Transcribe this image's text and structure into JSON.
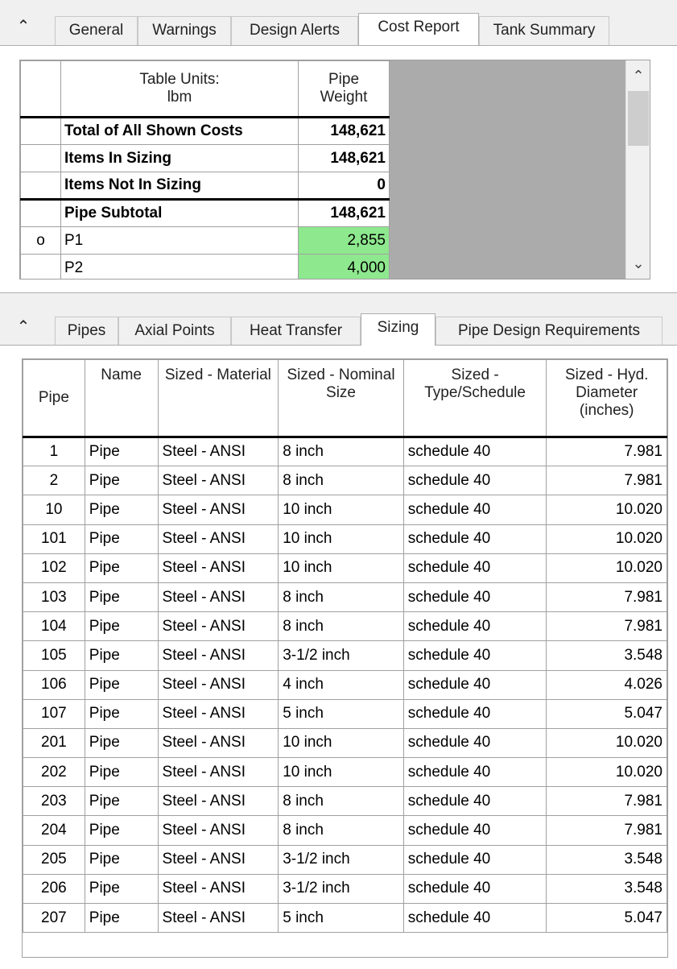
{
  "top_tabs": {
    "collapse_icon": "⌃",
    "tabs": [
      "General",
      "Warnings",
      "Design Alerts",
      "Cost Report",
      "Tank Summary"
    ],
    "active": "Cost Report"
  },
  "cost_report": {
    "header": {
      "units_label": "Table Units:",
      "units_value": "lbm",
      "col1": "Pipe",
      "col2": "Weight"
    },
    "rows": [
      {
        "selector": "",
        "label": "Total of All Shown Costs",
        "value": "148,621",
        "bold": true
      },
      {
        "selector": "",
        "label": "Items In Sizing",
        "value": "148,621",
        "bold": true
      },
      {
        "selector": "",
        "label": "Items Not In Sizing",
        "value": "0",
        "bold": true
      },
      {
        "selector": "",
        "label": "Pipe Subtotal",
        "value": "148,621",
        "bold": true
      },
      {
        "selector": "o",
        "label": "P1",
        "value": "2,855",
        "bold": false,
        "highlight": "#8ee88e"
      },
      {
        "selector": "",
        "label": "P2",
        "value": "4,000",
        "bold": false,
        "highlight": "#8ee88e"
      }
    ]
  },
  "bottom_tabs": {
    "collapse_icon": "⌃",
    "tabs": [
      "Pipes",
      "Axial Points",
      "Heat Transfer",
      "Sizing",
      "Pipe Design Requirements"
    ],
    "active": "Sizing"
  },
  "sizing": {
    "columns": [
      "Pipe",
      "Name",
      "Sized - Material",
      "Sized - Nominal Size",
      "Sized - Type/Schedule",
      "Sized - Hyd. Diameter (inches)"
    ],
    "rows": [
      [
        "1",
        "Pipe",
        "Steel - ANSI",
        "8 inch",
        "schedule 40",
        "7.981"
      ],
      [
        "2",
        "Pipe",
        "Steel - ANSI",
        "8 inch",
        "schedule 40",
        "7.981"
      ],
      [
        "10",
        "Pipe",
        "Steel - ANSI",
        "10 inch",
        "schedule 40",
        "10.020"
      ],
      [
        "101",
        "Pipe",
        "Steel - ANSI",
        "10 inch",
        "schedule 40",
        "10.020"
      ],
      [
        "102",
        "Pipe",
        "Steel - ANSI",
        "10 inch",
        "schedule 40",
        "10.020"
      ],
      [
        "103",
        "Pipe",
        "Steel - ANSI",
        "8 inch",
        "schedule 40",
        "7.981"
      ],
      [
        "104",
        "Pipe",
        "Steel - ANSI",
        "8 inch",
        "schedule 40",
        "7.981"
      ],
      [
        "105",
        "Pipe",
        "Steel - ANSI",
        "3-1/2 inch",
        "schedule 40",
        "3.548"
      ],
      [
        "106",
        "Pipe",
        "Steel - ANSI",
        "4 inch",
        "schedule 40",
        "4.026"
      ],
      [
        "107",
        "Pipe",
        "Steel - ANSI",
        "5 inch",
        "schedule 40",
        "5.047"
      ],
      [
        "201",
        "Pipe",
        "Steel - ANSI",
        "10 inch",
        "schedule 40",
        "10.020"
      ],
      [
        "202",
        "Pipe",
        "Steel - ANSI",
        "10 inch",
        "schedule 40",
        "10.020"
      ],
      [
        "203",
        "Pipe",
        "Steel - ANSI",
        "8 inch",
        "schedule 40",
        "7.981"
      ],
      [
        "204",
        "Pipe",
        "Steel - ANSI",
        "8 inch",
        "schedule 40",
        "7.981"
      ],
      [
        "205",
        "Pipe",
        "Steel - ANSI",
        "3-1/2 inch",
        "schedule 40",
        "3.548"
      ],
      [
        "206",
        "Pipe",
        "Steel - ANSI",
        "3-1/2 inch",
        "schedule 40",
        "3.548"
      ],
      [
        "207",
        "Pipe",
        "Steel - ANSI",
        "5 inch",
        "schedule 40",
        "5.047"
      ]
    ]
  },
  "icons": {
    "scroll_up": "chevron-up-icon",
    "scroll_down": "chevron-down-icon"
  }
}
